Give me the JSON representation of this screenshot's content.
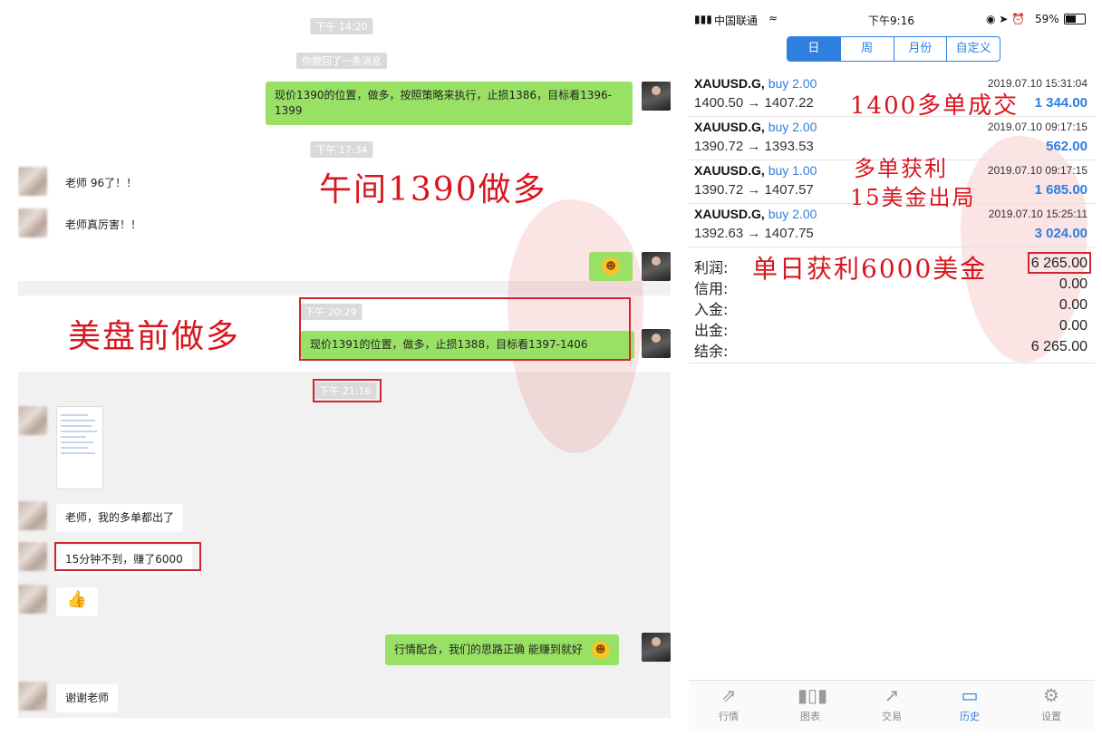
{
  "chat": {
    "ts1": "下午 14:20",
    "recall_notice": "你撤回了一条消息",
    "msg1": "现价1390的位置，做多，按照策略来执行，止损1386，目标看1396-1399",
    "ts2": "下午 17:34",
    "msg2": "老师 96了！！",
    "msg3": "老师真厉害！！",
    "ts3": "下午 20:29",
    "msg4": "现价1391的位置，做多，止损1388，目标看1397-1406",
    "ts4": "下午 21:16",
    "msg5": "老师，我的多单都出了",
    "msg6": "15分钟不到，赚了6000",
    "msg7": "行情配合，我们的思路正确 能赚到就好",
    "msg8": "谢谢老师"
  },
  "annotations": {
    "noon": "午间1390做多",
    "us": "美盘前做多",
    "deal1400": "1400多单成交",
    "profit_a": "多单获利",
    "profit_b": "15美金出局",
    "daily": "单日获利6000美金"
  },
  "phone": {
    "carrier": "中国联通",
    "time": "下午9:16",
    "battery": "59%",
    "periods": [
      "日",
      "周",
      "月份",
      "自定义"
    ],
    "deals": [
      {
        "symbol": "XAUUSD.G,",
        "side": "buy 2.00",
        "prices": "1400.50 → 1407.22",
        "datetime": "2019.07.10 15:31:04",
        "profit": "1 344.00"
      },
      {
        "symbol": "XAUUSD.G,",
        "side": "buy 2.00",
        "prices": "1390.72 → 1393.53",
        "datetime": "2019.07.10 09:17:15",
        "profit": "562.00"
      },
      {
        "symbol": "XAUUSD.G,",
        "side": "buy 1.00",
        "prices": "1390.72 → 1407.57",
        "datetime": "2019.07.10 09:17:15",
        "profit": "1 685.00"
      },
      {
        "symbol": "XAUUSD.G,",
        "side": "buy 2.00",
        "prices": "1392.63 → 1407.75",
        "datetime": "2019.07.10 15:25:11",
        "profit": "3 024.00"
      }
    ],
    "summary": [
      {
        "label": "利润:",
        "value": "6 265.00"
      },
      {
        "label": "信用:",
        "value": "0.00"
      },
      {
        "label": "入金:",
        "value": "0.00"
      },
      {
        "label": "出金:",
        "value": "0.00"
      },
      {
        "label": "结余:",
        "value": "6 265.00"
      }
    ],
    "tabs": [
      "行情",
      "图表",
      "交易",
      "历史",
      "设置"
    ]
  }
}
